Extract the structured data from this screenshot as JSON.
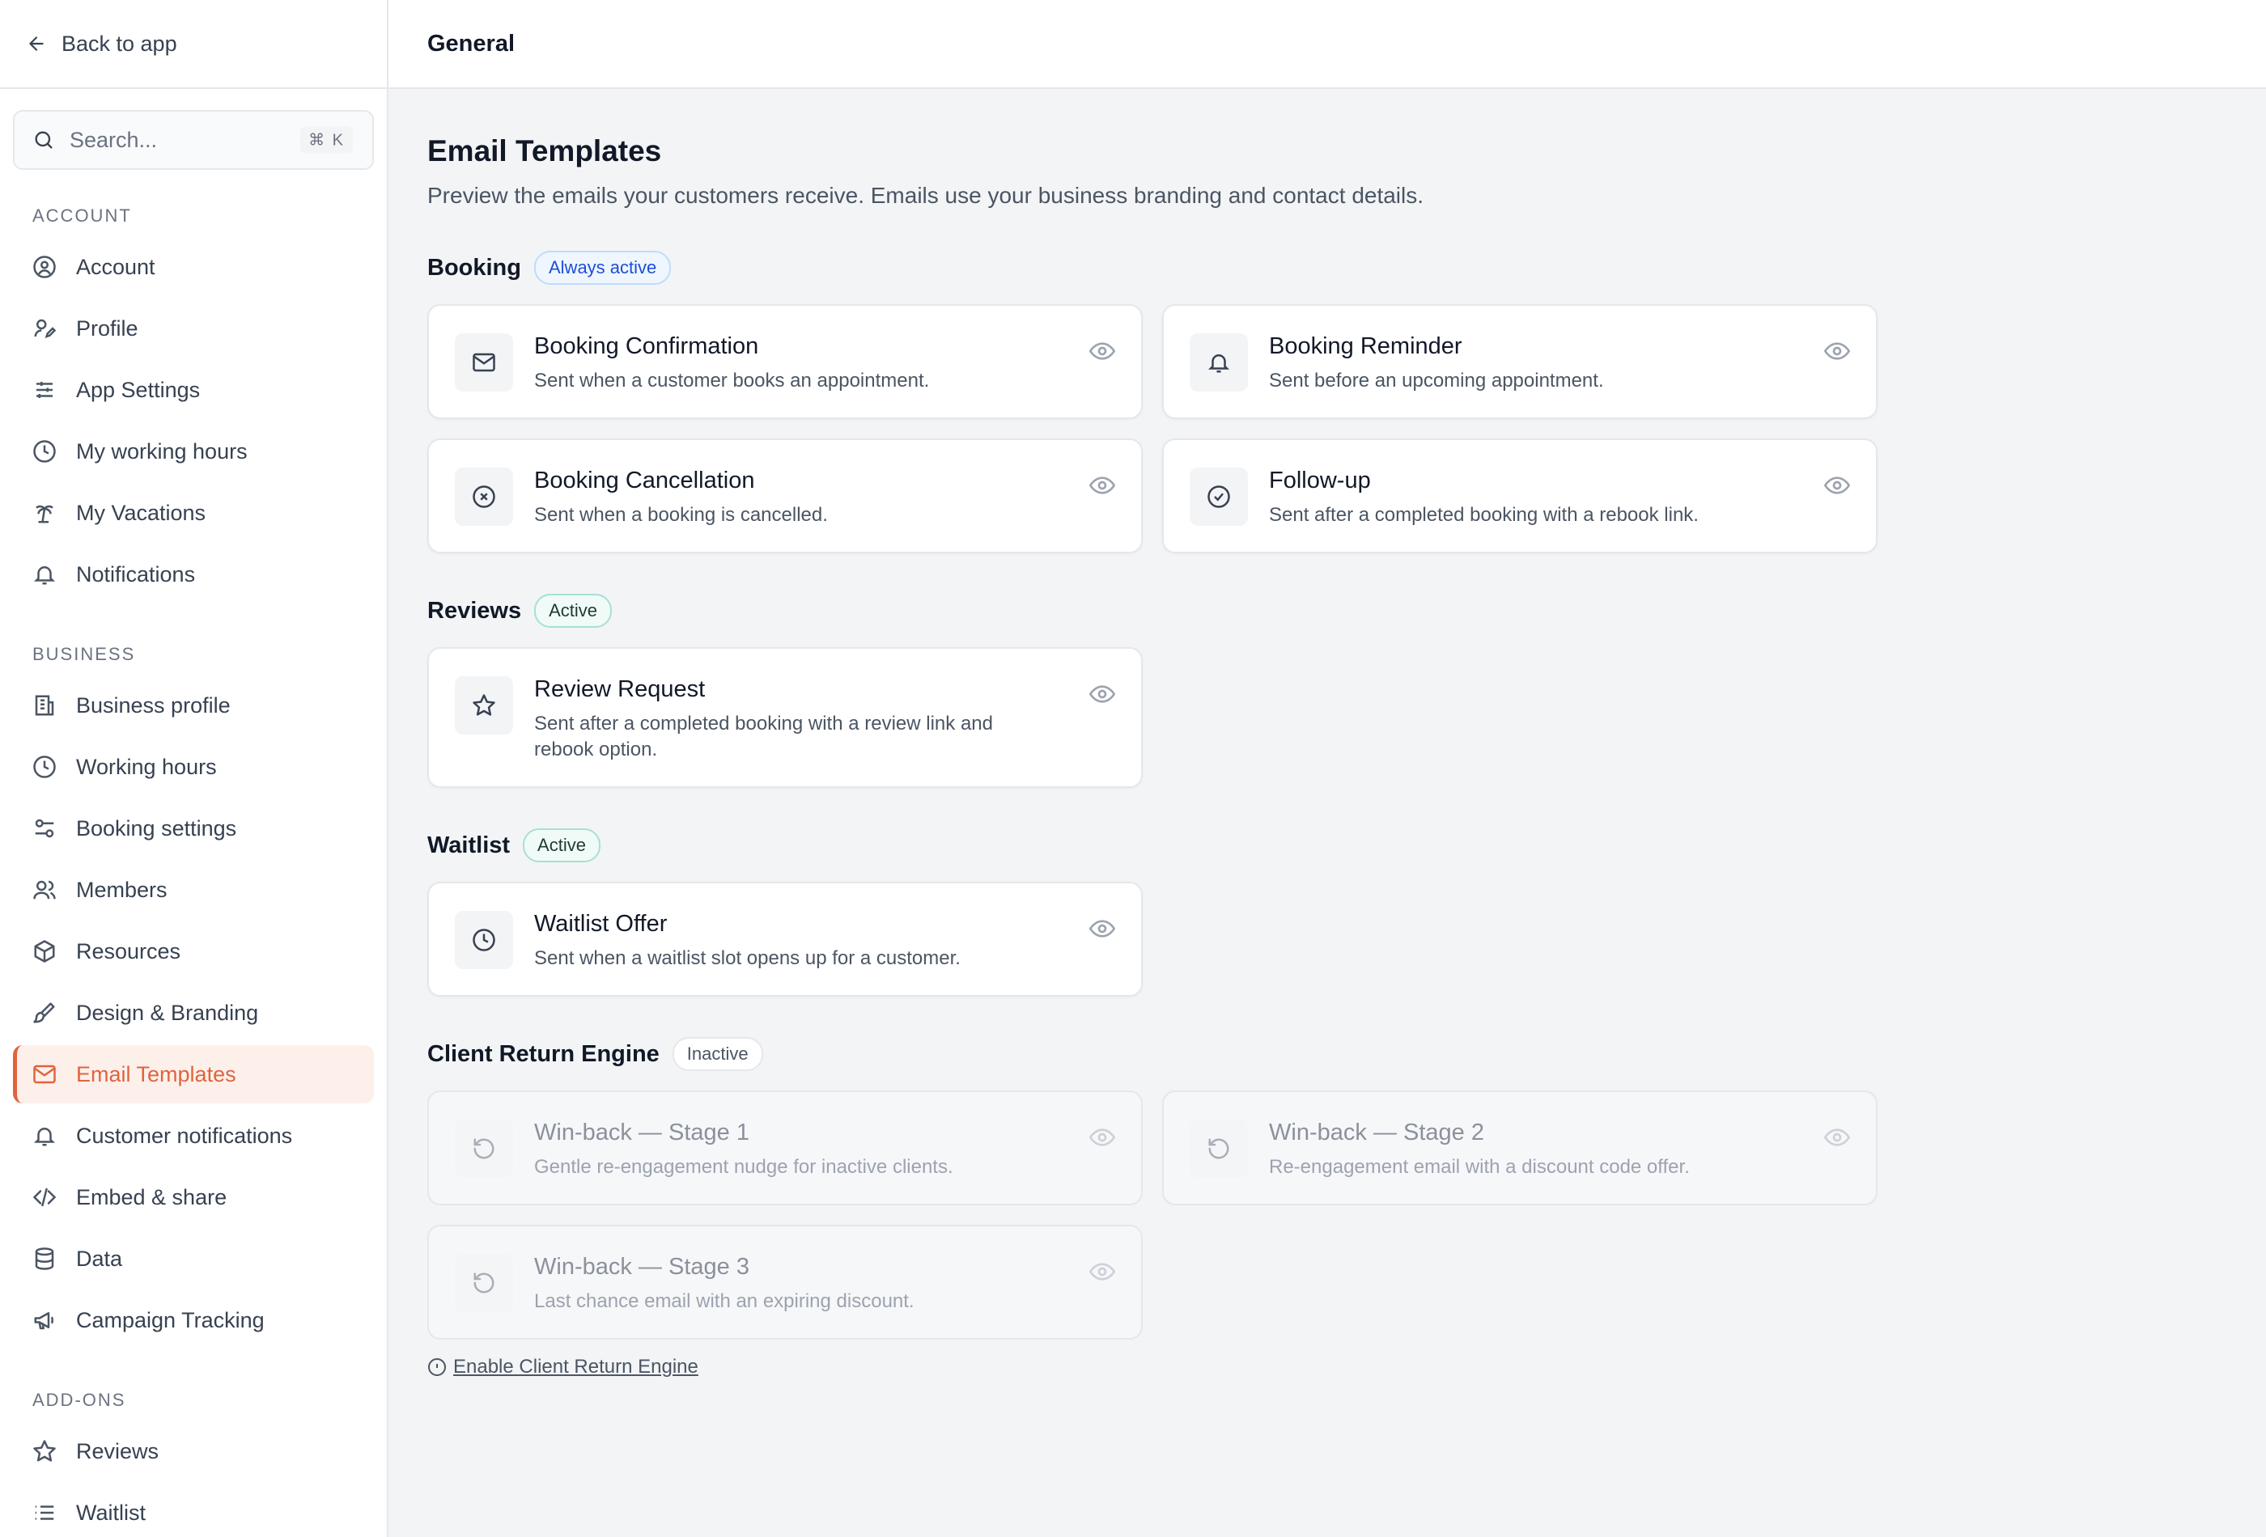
{
  "sidebar": {
    "back_label": "Back to app",
    "search_placeholder": "Search...",
    "search_shortcut": "⌘ K",
    "sections": [
      {
        "title": "ACCOUNT",
        "items": [
          "Account",
          "Profile",
          "App Settings",
          "My working hours",
          "My Vacations",
          "Notifications"
        ]
      },
      {
        "title": "BUSINESS",
        "items": [
          "Business profile",
          "Working hours",
          "Booking settings",
          "Members",
          "Resources",
          "Design & Branding",
          "Email Templates",
          "Customer notifications",
          "Embed & share",
          "Data",
          "Campaign Tracking"
        ]
      },
      {
        "title": "ADD-ONS",
        "items": [
          "Reviews",
          "Waitlist"
        ]
      }
    ],
    "active_item": "Email Templates"
  },
  "header": {
    "title": "General"
  },
  "main": {
    "title": "Email Templates",
    "subtitle": "Preview the emails your customers receive. Emails use your business branding and contact details.",
    "groups": [
      {
        "name": "Booking",
        "badge": "Always active",
        "cards": [
          {
            "title": "Booking Confirmation",
            "desc": "Sent when a customer books an appointment.",
            "icon": "mail-icon"
          },
          {
            "title": "Booking Reminder",
            "desc": "Sent before an upcoming appointment.",
            "icon": "bell-icon"
          },
          {
            "title": "Booking Cancellation",
            "desc": "Sent when a booking is cancelled.",
            "icon": "x-circle-icon"
          },
          {
            "title": "Follow-up",
            "desc": "Sent after a completed booking with a rebook link.",
            "icon": "check-circle-icon"
          }
        ]
      },
      {
        "name": "Reviews",
        "badge": "Active",
        "cards": [
          {
            "title": "Review Request",
            "desc": "Sent after a completed booking with a review link and rebook option.",
            "icon": "star-icon"
          }
        ]
      },
      {
        "name": "Waitlist",
        "badge": "Active",
        "cards": [
          {
            "title": "Waitlist Offer",
            "desc": "Sent when a waitlist slot opens up for a customer.",
            "icon": "clock-icon"
          }
        ]
      },
      {
        "name": "Client Return Engine",
        "badge": "Inactive",
        "cards": [
          {
            "title": "Win-back — Stage 1",
            "desc": "Gentle re-engagement nudge for inactive clients.",
            "icon": "rotate-ccw-icon"
          },
          {
            "title": "Win-back — Stage 2",
            "desc": "Re-engagement email with a discount code offer.",
            "icon": "rotate-ccw-icon"
          },
          {
            "title": "Win-back — Stage 3",
            "desc": "Last chance email with an expiring discount.",
            "icon": "rotate-ccw-icon"
          }
        ]
      }
    ],
    "enable_link": "Enable Client Return Engine"
  },
  "colors": {
    "accent": "#e0643e",
    "active_bg": "#fdf0eb"
  }
}
